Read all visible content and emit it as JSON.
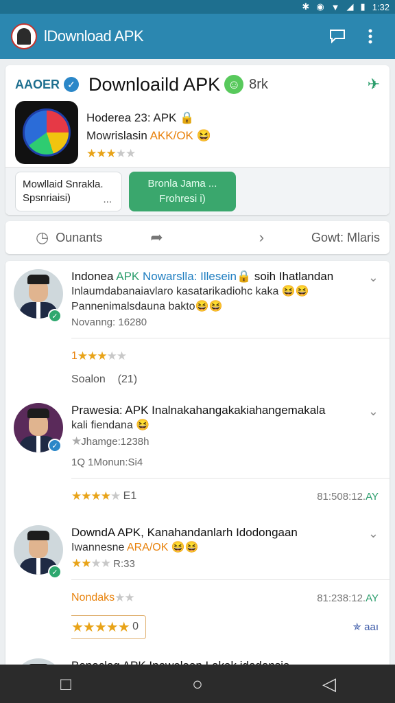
{
  "status_bar": {
    "time": "1:32"
  },
  "app_bar": {
    "title": "lDownload APK"
  },
  "app_card": {
    "brand": "AAOER",
    "title": "Downloaild APK",
    "size": "8rk",
    "line1": "Hoderea 23: APK",
    "line2_prefix": "Mowrislasin ",
    "line2_highlight": "AKK/OK",
    "rating_stars": 3,
    "secondary_button_line1": "Mowllaid Snrakla.",
    "secondary_button_line2": "Spsnriaisi)",
    "secondary_button_dots": "...",
    "primary_button_line1": "Bronla Jama ...",
    "primary_button_line2": "Frohresi i)"
  },
  "tabs": {
    "left_label": "Ounants",
    "right_label": "Gowt: Mlaris"
  },
  "reviews": [
    {
      "title_prefix": "Indonea",
      "title_green": "APK",
      "title_blue": "Nowarslla: Illesein",
      "title_suffix": "soih Ihatlandan",
      "body": "Inlaumdabanaiavlaro kasatarikadiohc kaka",
      "body2": "Pannenimalsdauna bakto",
      "meta": "Novanng: 16280",
      "stars_prefix": "1",
      "rating_stars": 3,
      "footer_label": "Soalon",
      "footer_count": "(21)"
    },
    {
      "title": "Prawesia: APK Inalnakahangakakiahangemakala",
      "body": "kali fiendana",
      "meta": "Jhamge:1238h",
      "extra": "1Q 1Monun:Si4",
      "rating_stars": 4,
      "rating_suffix": "E1",
      "time": "81:508:12.",
      "time_suffix": "AY"
    },
    {
      "title": "DowndA APK, Kanahandanlarh Idodongaan",
      "body_prefix": "Iwannesne ",
      "body_highlight": "ARA/OK",
      "meta": "R:33",
      "rating_stars": 2,
      "label": "Nondaks",
      "time": "81:238:12.",
      "time_suffix": "AY",
      "rating_box_stars": 5,
      "rating_box_value": "0",
      "share_label": "aaı"
    },
    {
      "title": "Benoclaq APK Inowolaan Lakak idodonsia"
    }
  ],
  "nav": {
    "back_icon": "◁",
    "home_icon": "○",
    "recents_icon": "□"
  }
}
